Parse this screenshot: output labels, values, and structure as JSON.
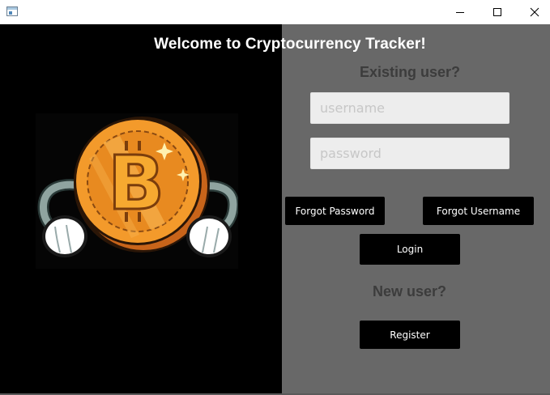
{
  "window": {
    "title": "",
    "icon": "app-window-icon",
    "controls": [
      "minimize-icon",
      "maximize-icon",
      "close-icon"
    ]
  },
  "header": {
    "welcome": "Welcome to Cryptocurrency Tracker!"
  },
  "login": {
    "heading": "Existing user?",
    "username_placeholder": "username",
    "password_placeholder": "password",
    "username_value": "",
    "password_value": "",
    "forgot_password_label": "Forgot Password",
    "forgot_username_label": "Forgot Username",
    "login_label": "Login"
  },
  "register": {
    "heading": "New user?",
    "register_label": "Register"
  },
  "illustration": {
    "icon": "bitcoin-mascot-icon"
  },
  "colors": {
    "left_panel": "#000000",
    "right_panel": "#686868",
    "button_bg": "#000000",
    "field_bg": "#ededed",
    "heading_text": "#3c3c3c",
    "coin_orange": "#f39a2b"
  }
}
